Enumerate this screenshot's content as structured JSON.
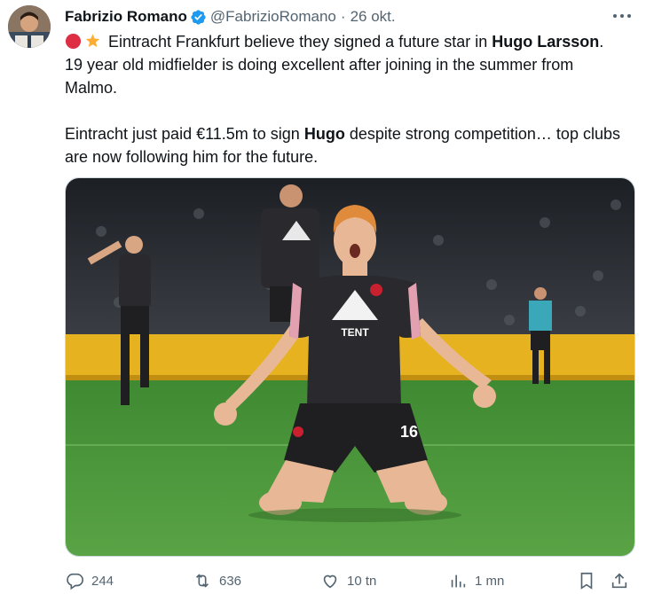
{
  "tweet": {
    "author": {
      "name": "Fabrizio Romano",
      "handle": "@FabrizioRomano",
      "dot": "·",
      "date": "26 okt."
    },
    "text": {
      "l1_pre": "Eintracht Frankfurt believe they signed a future star in ",
      "l1_bold": "Hugo Larsson",
      "l1_post": ". 19 year old midfielder is doing excellent after joining in the summer from Malmo.",
      "l2_pre": "Eintracht just paid €11.5m to sign ",
      "l2_bold": "Hugo",
      "l2_post": " despite strong competition… top clubs are now following him for the future."
    },
    "media": {
      "shirt_sponsor": "TENT",
      "shirt_number": "16",
      "colors": {
        "shirt": "#2a2a2e",
        "hair": "#e08a3c",
        "skin": "#e8b896",
        "pitch": "#4f9a3e",
        "board": "#e7b21f"
      }
    },
    "actions": {
      "replies": "244",
      "retweets": "636",
      "likes": "10 tn",
      "views": "1 mn"
    },
    "icons": [
      "verified-badge-icon",
      "red-circle-emoji",
      "star-emoji",
      "more-icon",
      "reply-icon",
      "retweet-icon",
      "like-icon",
      "views-icon",
      "bookmark-icon",
      "share-icon"
    ],
    "accent": "#1d9bf0"
  }
}
